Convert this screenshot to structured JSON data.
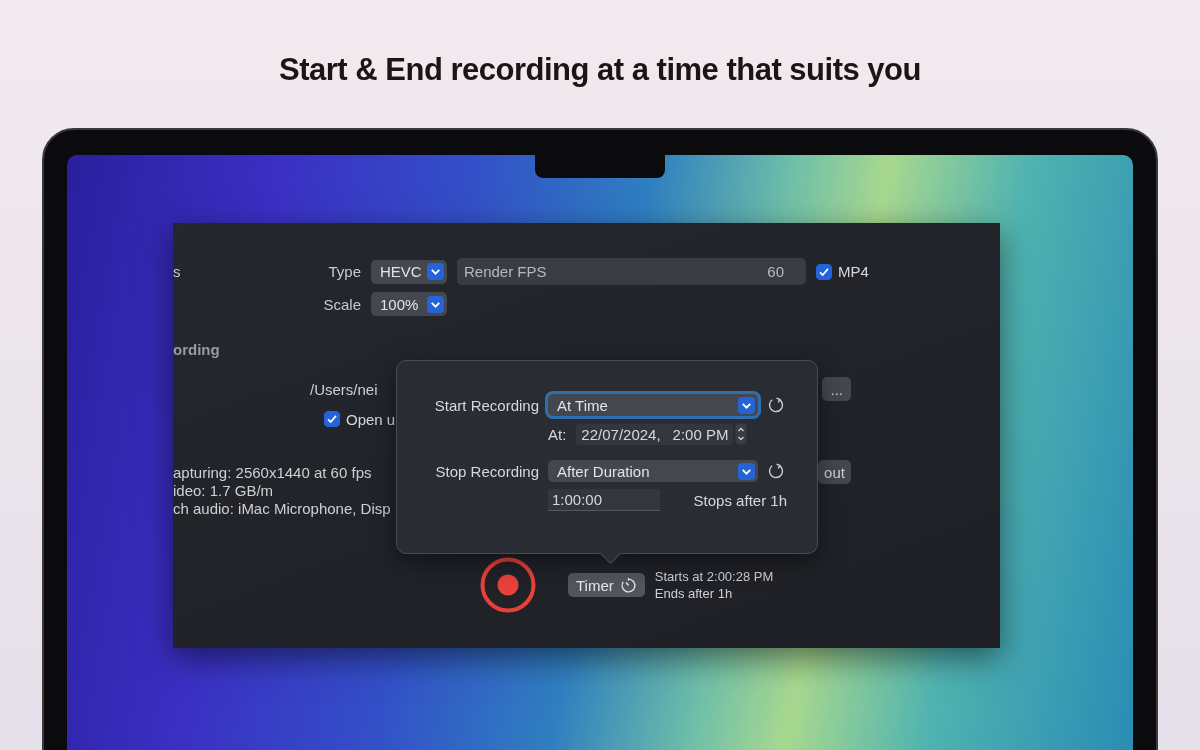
{
  "headline": "Start & End recording at a time that suits you",
  "window": {
    "section_1_label": "s",
    "type": {
      "label": "Type",
      "value": "HEVC"
    },
    "render_fps": {
      "label": "Render FPS",
      "value": "60"
    },
    "mp4": {
      "label": "MP4",
      "checked": true
    },
    "scale": {
      "label": "Scale",
      "value": "100%"
    },
    "section_2_heading": "ording",
    "path": "/Users/nei",
    "choose_button": "...",
    "open_checkbox": {
      "label": "Open u",
      "checked": true
    },
    "info_lines": [
      "apturing: 2560x1440 at 60 fps",
      "ideo: 1.7 GB/m",
      "ch audio: iMac Microphone, Disp"
    ],
    "layout_button": "out",
    "timer_button": "Timer",
    "timer_status": [
      "Starts at 2:00:28 PM",
      "Ends after 1h"
    ]
  },
  "popover": {
    "start": {
      "label": "Start Recording",
      "value": "At Time",
      "focused": true
    },
    "at_label": "At:",
    "date": "22/07/2024,",
    "time": "2:00 PM",
    "stop": {
      "label": "Stop Recording",
      "value": "After Duration",
      "focused": false
    },
    "duration": "1:00:00",
    "stop_note": "Stops after 1h"
  }
}
